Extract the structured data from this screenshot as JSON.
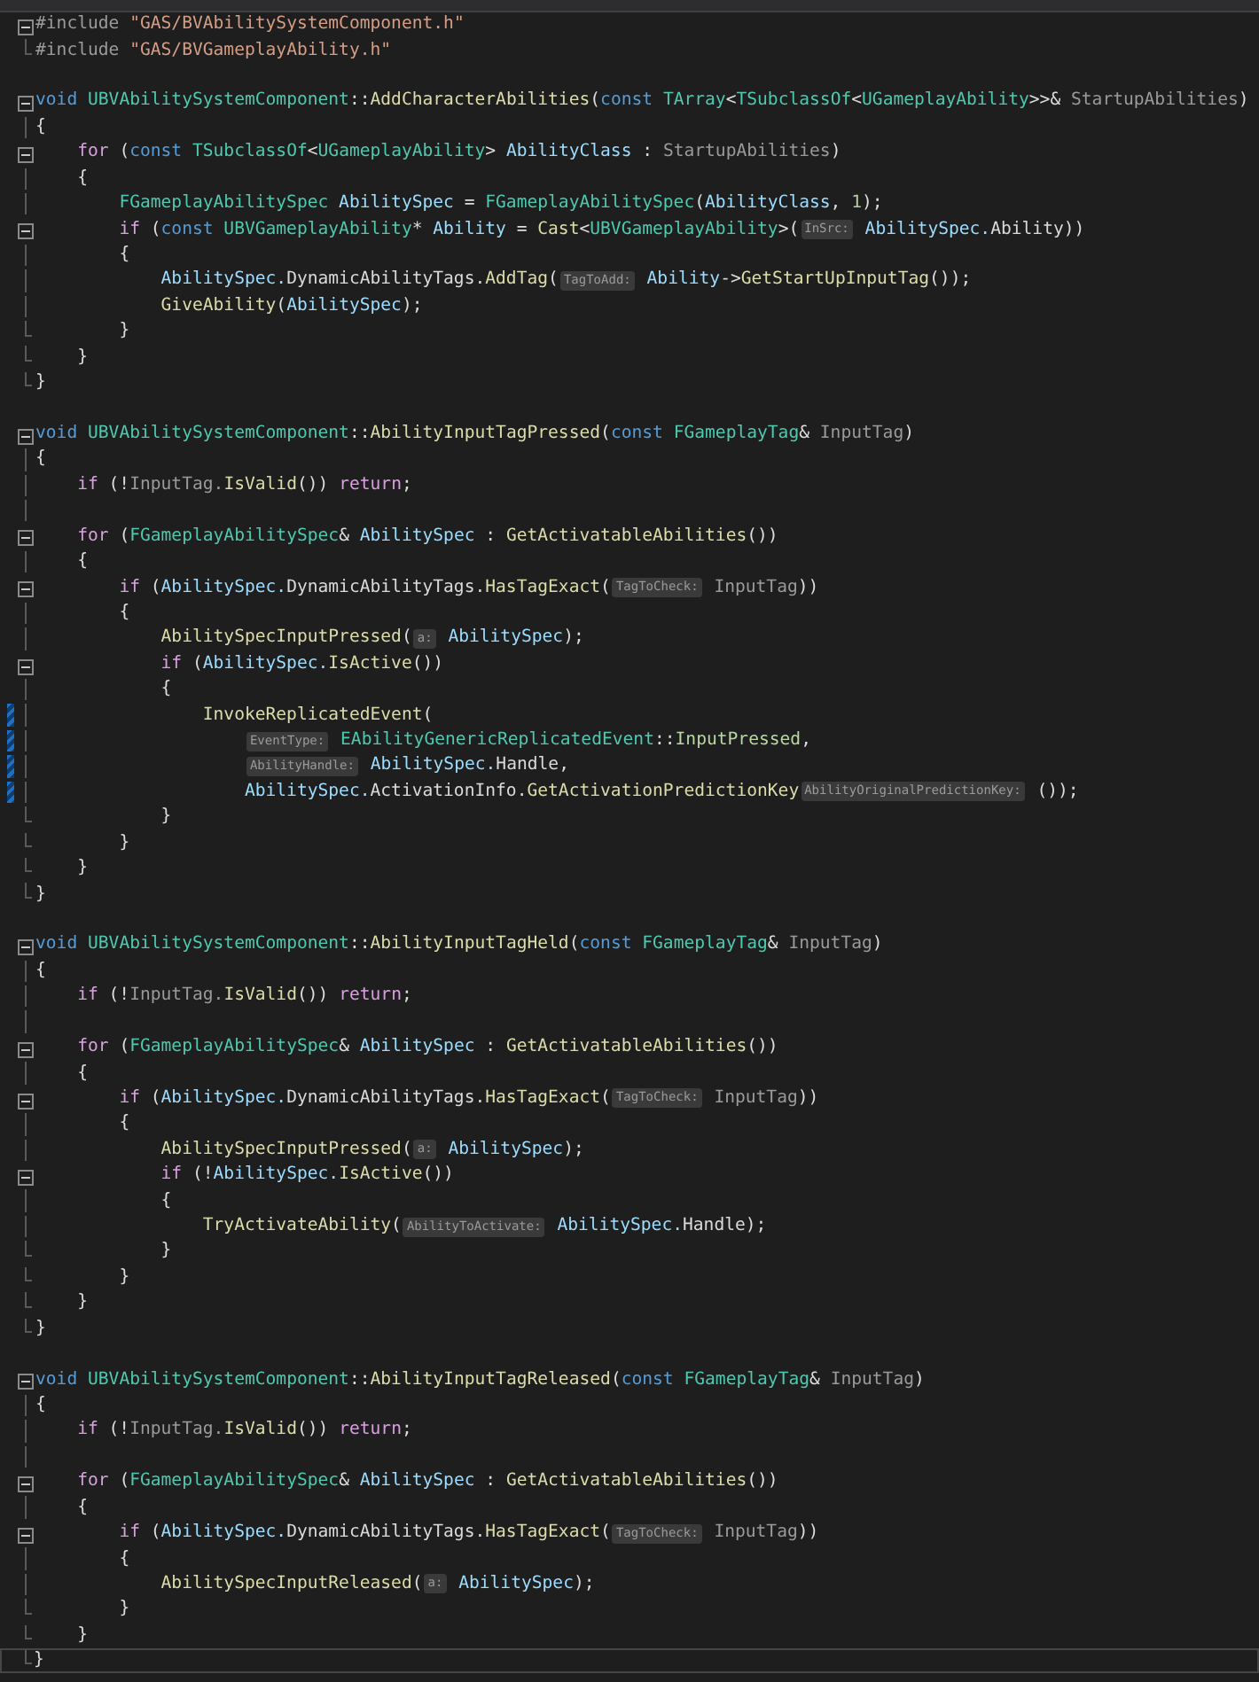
{
  "lines": [
    {
      "kind": "fold",
      "changed": false,
      "current": false,
      "tokens": [
        {
          "kind": "pre",
          "text": "#include "
        },
        {
          "kind": "str",
          "text": "\"GAS/BVAbilitySystemComponent.h\""
        }
      ]
    },
    {
      "kind": "end",
      "changed": false,
      "current": false,
      "tokens": [
        {
          "kind": "pre",
          "text": "#include "
        },
        {
          "kind": "str",
          "text": "\"GAS/BVGameplayAbility.h\""
        }
      ]
    },
    {
      "kind": "none",
      "changed": false,
      "current": false
    },
    {
      "kind": "fold",
      "changed": false,
      "current": false,
      "tokens": [
        {
          "kind": "kw",
          "text": "void "
        },
        {
          "kind": "type",
          "text": "UBVAbilitySystemComponent"
        },
        {
          "kind": "p",
          "text": "::"
        },
        {
          "kind": "fn",
          "text": "AddCharacterAbilities"
        },
        {
          "kind": "p",
          "text": "("
        },
        {
          "kind": "kw",
          "text": "const "
        },
        {
          "kind": "type",
          "text": "TArray"
        },
        {
          "kind": "p",
          "text": "<"
        },
        {
          "kind": "type",
          "text": "TSubclassOf"
        },
        {
          "kind": "p",
          "text": "<"
        },
        {
          "kind": "type",
          "text": "UGameplayAbility"
        },
        {
          "kind": "p",
          "text": ">>& "
        },
        {
          "kind": "param",
          "text": "StartupAbilities"
        },
        {
          "kind": "p",
          "text": ")"
        }
      ]
    },
    {
      "kind": "line",
      "changed": false,
      "current": false,
      "tokens": [
        {
          "kind": "p",
          "text": "{"
        }
      ]
    },
    {
      "kind": "fold",
      "changed": false,
      "current": false,
      "tokens": [
        {
          "kind": "ctl",
          "text": "    for"
        },
        {
          "kind": "p",
          "text": " ("
        },
        {
          "kind": "kw",
          "text": "const "
        },
        {
          "kind": "type",
          "text": "TSubclassOf"
        },
        {
          "kind": "p",
          "text": "<"
        },
        {
          "kind": "type",
          "text": "UGameplayAbility"
        },
        {
          "kind": "p",
          "text": "> "
        },
        {
          "kind": "var",
          "text": "AbilityClass"
        },
        {
          "kind": "p",
          "text": " : "
        },
        {
          "kind": "param",
          "text": "StartupAbilities"
        },
        {
          "kind": "p",
          "text": ")"
        }
      ]
    },
    {
      "kind": "line",
      "changed": false,
      "current": false,
      "tokens": [
        {
          "kind": "p",
          "text": "    {"
        }
      ]
    },
    {
      "kind": "line",
      "changed": false,
      "current": false,
      "tokens": [
        {
          "kind": "type",
          "text": "        FGameplayAbilitySpec"
        },
        {
          "kind": "var",
          "text": " AbilitySpec"
        },
        {
          "kind": "p",
          "text": " = "
        },
        {
          "kind": "type",
          "text": "FGameplayAbilitySpec"
        },
        {
          "kind": "p",
          "text": "("
        },
        {
          "kind": "var",
          "text": "AbilityClass"
        },
        {
          "kind": "p",
          "text": ", "
        },
        {
          "kind": "num",
          "text": "1"
        },
        {
          "kind": "p",
          "text": ");"
        }
      ]
    },
    {
      "kind": "fold",
      "changed": false,
      "current": false,
      "tokens": [
        {
          "kind": "ctl",
          "text": "        if"
        },
        {
          "kind": "p",
          "text": " ("
        },
        {
          "kind": "kw",
          "text": "const "
        },
        {
          "kind": "type",
          "text": "UBVGameplayAbility"
        },
        {
          "kind": "p",
          "text": "* "
        },
        {
          "kind": "var",
          "text": "Ability"
        },
        {
          "kind": "p",
          "text": " = "
        },
        {
          "kind": "fn",
          "text": "Cast"
        },
        {
          "kind": "p",
          "text": "<"
        },
        {
          "kind": "type",
          "text": "UBVGameplayAbility"
        },
        {
          "kind": "p",
          "text": ">("
        },
        {
          "kind": "hint",
          "text": "InSrc:"
        },
        {
          "kind": "var",
          "text": " AbilitySpec."
        },
        {
          "kind": "mem",
          "text": "Ability"
        },
        {
          "kind": "p",
          "text": "))"
        }
      ]
    },
    {
      "kind": "line",
      "changed": false,
      "current": false,
      "tokens": [
        {
          "kind": "p",
          "text": "        {"
        }
      ]
    },
    {
      "kind": "line",
      "changed": false,
      "current": false,
      "tokens": [
        {
          "kind": "var",
          "text": "            AbilitySpec."
        },
        {
          "kind": "mem",
          "text": "DynamicAbilityTags."
        },
        {
          "kind": "fn",
          "text": "AddTag"
        },
        {
          "kind": "p",
          "text": "("
        },
        {
          "kind": "hint",
          "text": "TagToAdd:"
        },
        {
          "kind": "var",
          "text": " Ability"
        },
        {
          "kind": "p",
          "text": "->"
        },
        {
          "kind": "fn",
          "text": "GetStartUpInputTag"
        },
        {
          "kind": "p",
          "text": "());"
        }
      ]
    },
    {
      "kind": "line",
      "changed": false,
      "current": false,
      "tokens": [
        {
          "kind": "fn",
          "text": "            GiveAbility"
        },
        {
          "kind": "p",
          "text": "("
        },
        {
          "kind": "var",
          "text": "AbilitySpec"
        },
        {
          "kind": "p",
          "text": ");"
        }
      ]
    },
    {
      "kind": "end",
      "changed": false,
      "current": false,
      "tokens": [
        {
          "kind": "p",
          "text": "        }"
        }
      ]
    },
    {
      "kind": "end",
      "changed": false,
      "current": false,
      "tokens": [
        {
          "kind": "p",
          "text": "    }"
        }
      ]
    },
    {
      "kind": "end",
      "changed": false,
      "current": false,
      "tokens": [
        {
          "kind": "p",
          "text": "}"
        }
      ]
    },
    {
      "kind": "none",
      "changed": false,
      "current": false
    },
    {
      "kind": "fold",
      "changed": false,
      "current": false,
      "tokens": [
        {
          "kind": "kw",
          "text": "void "
        },
        {
          "kind": "type",
          "text": "UBVAbilitySystemComponent"
        },
        {
          "kind": "p",
          "text": "::"
        },
        {
          "kind": "fn",
          "text": "AbilityInputTagPressed"
        },
        {
          "kind": "p",
          "text": "("
        },
        {
          "kind": "kw",
          "text": "const "
        },
        {
          "kind": "type",
          "text": "FGameplayTag"
        },
        {
          "kind": "p",
          "text": "& "
        },
        {
          "kind": "param",
          "text": "InputTag"
        },
        {
          "kind": "p",
          "text": ")"
        }
      ]
    },
    {
      "kind": "line",
      "changed": false,
      "current": false,
      "tokens": [
        {
          "kind": "p",
          "text": "{"
        }
      ]
    },
    {
      "kind": "line",
      "changed": false,
      "current": false,
      "tokens": [
        {
          "kind": "ctl",
          "text": "    if"
        },
        {
          "kind": "p",
          "text": " (!"
        },
        {
          "kind": "param",
          "text": "InputTag."
        },
        {
          "kind": "fn",
          "text": "IsValid"
        },
        {
          "kind": "p",
          "text": "()) "
        },
        {
          "kind": "ctl",
          "text": "return"
        },
        {
          "kind": "p",
          "text": ";"
        }
      ]
    },
    {
      "kind": "line",
      "changed": false,
      "current": false
    },
    {
      "kind": "fold",
      "changed": false,
      "current": false,
      "tokens": [
        {
          "kind": "ctl",
          "text": "    for"
        },
        {
          "kind": "p",
          "text": " ("
        },
        {
          "kind": "type",
          "text": "FGameplayAbilitySpec"
        },
        {
          "kind": "p",
          "text": "& "
        },
        {
          "kind": "var",
          "text": "AbilitySpec"
        },
        {
          "kind": "p",
          "text": " : "
        },
        {
          "kind": "fn",
          "text": "GetActivatableAbilities"
        },
        {
          "kind": "p",
          "text": "())"
        }
      ]
    },
    {
      "kind": "line",
      "changed": false,
      "current": false,
      "tokens": [
        {
          "kind": "p",
          "text": "    {"
        }
      ]
    },
    {
      "kind": "fold",
      "changed": false,
      "current": false,
      "tokens": [
        {
          "kind": "ctl",
          "text": "        if"
        },
        {
          "kind": "p",
          "text": " ("
        },
        {
          "kind": "var",
          "text": "AbilitySpec."
        },
        {
          "kind": "mem",
          "text": "DynamicAbilityTags."
        },
        {
          "kind": "fn",
          "text": "HasTagExact"
        },
        {
          "kind": "p",
          "text": "("
        },
        {
          "kind": "hint",
          "text": "TagToCheck:"
        },
        {
          "kind": "param",
          "text": " InputTag"
        },
        {
          "kind": "p",
          "text": "))"
        }
      ]
    },
    {
      "kind": "line",
      "changed": false,
      "current": false,
      "tokens": [
        {
          "kind": "p",
          "text": "        {"
        }
      ]
    },
    {
      "kind": "line",
      "changed": false,
      "current": false,
      "tokens": [
        {
          "kind": "fn",
          "text": "            AbilitySpecInputPressed"
        },
        {
          "kind": "p",
          "text": "("
        },
        {
          "kind": "hint",
          "text": "a:"
        },
        {
          "kind": "var",
          "text": " AbilitySpec"
        },
        {
          "kind": "p",
          "text": ");"
        }
      ]
    },
    {
      "kind": "fold",
      "changed": false,
      "current": false,
      "tokens": [
        {
          "kind": "ctl",
          "text": "            if"
        },
        {
          "kind": "p",
          "text": " ("
        },
        {
          "kind": "var",
          "text": "AbilitySpec."
        },
        {
          "kind": "fn",
          "text": "IsActive"
        },
        {
          "kind": "p",
          "text": "())"
        }
      ]
    },
    {
      "kind": "line",
      "changed": false,
      "current": false,
      "tokens": [
        {
          "kind": "p",
          "text": "            {"
        }
      ]
    },
    {
      "kind": "line",
      "changed": true,
      "current": false,
      "tokens": [
        {
          "kind": "fn",
          "text": "                InvokeReplicatedEvent"
        },
        {
          "kind": "p",
          "text": "("
        }
      ]
    },
    {
      "kind": "line",
      "changed": true,
      "current": false,
      "tokens": [
        {
          "kind": "hint",
          "text": "                    EventType:"
        },
        {
          "kind": "type",
          "text": " EAbilityGenericReplicatedEvent"
        },
        {
          "kind": "p",
          "text": "::"
        },
        {
          "kind": "enum",
          "text": "InputPressed"
        },
        {
          "kind": "p",
          "text": ","
        }
      ]
    },
    {
      "kind": "line",
      "changed": true,
      "current": false,
      "tokens": [
        {
          "kind": "hint",
          "text": "                    AbilityHandle:"
        },
        {
          "kind": "var",
          "text": " AbilitySpec."
        },
        {
          "kind": "mem",
          "text": "Handle"
        },
        {
          "kind": "p",
          "text": ","
        }
      ]
    },
    {
      "kind": "line",
      "changed": true,
      "current": false,
      "tokens": [
        {
          "kind": "var",
          "text": "                    AbilitySpec."
        },
        {
          "kind": "mem",
          "text": "ActivationInfo."
        },
        {
          "kind": "fn",
          "text": "GetActivationPredictionKey"
        },
        {
          "kind": "hint",
          "text": "AbilityOriginalPredictionKey:"
        },
        {
          "kind": "p",
          "text": " ());"
        }
      ]
    },
    {
      "kind": "end",
      "changed": false,
      "current": false,
      "tokens": [
        {
          "kind": "p",
          "text": "            }"
        }
      ]
    },
    {
      "kind": "end",
      "changed": false,
      "current": false,
      "tokens": [
        {
          "kind": "p",
          "text": "        }"
        }
      ]
    },
    {
      "kind": "end",
      "changed": false,
      "current": false,
      "tokens": [
        {
          "kind": "p",
          "text": "    }"
        }
      ]
    },
    {
      "kind": "end",
      "changed": false,
      "current": false,
      "tokens": [
        {
          "kind": "p",
          "text": "}"
        }
      ]
    },
    {
      "kind": "none",
      "changed": false,
      "current": false
    },
    {
      "kind": "fold",
      "changed": false,
      "current": false,
      "tokens": [
        {
          "kind": "kw",
          "text": "void "
        },
        {
          "kind": "type",
          "text": "UBVAbilitySystemComponent"
        },
        {
          "kind": "p",
          "text": "::"
        },
        {
          "kind": "fn",
          "text": "AbilityInputTagHeld"
        },
        {
          "kind": "p",
          "text": "("
        },
        {
          "kind": "kw",
          "text": "const "
        },
        {
          "kind": "type",
          "text": "FGameplayTag"
        },
        {
          "kind": "p",
          "text": "& "
        },
        {
          "kind": "param",
          "text": "InputTag"
        },
        {
          "kind": "p",
          "text": ")"
        }
      ]
    },
    {
      "kind": "line",
      "changed": false,
      "current": false,
      "tokens": [
        {
          "kind": "p",
          "text": "{"
        }
      ]
    },
    {
      "kind": "line",
      "changed": false,
      "current": false,
      "tokens": [
        {
          "kind": "ctl",
          "text": "    if"
        },
        {
          "kind": "p",
          "text": " (!"
        },
        {
          "kind": "param",
          "text": "InputTag."
        },
        {
          "kind": "fn",
          "text": "IsValid"
        },
        {
          "kind": "p",
          "text": "()) "
        },
        {
          "kind": "ctl",
          "text": "return"
        },
        {
          "kind": "p",
          "text": ";"
        }
      ]
    },
    {
      "kind": "line",
      "changed": false,
      "current": false
    },
    {
      "kind": "fold",
      "changed": false,
      "current": false,
      "tokens": [
        {
          "kind": "ctl",
          "text": "    for"
        },
        {
          "kind": "p",
          "text": " ("
        },
        {
          "kind": "type",
          "text": "FGameplayAbilitySpec"
        },
        {
          "kind": "p",
          "text": "& "
        },
        {
          "kind": "var",
          "text": "AbilitySpec"
        },
        {
          "kind": "p",
          "text": " : "
        },
        {
          "kind": "fn",
          "text": "GetActivatableAbilities"
        },
        {
          "kind": "p",
          "text": "())"
        }
      ]
    },
    {
      "kind": "line",
      "changed": false,
      "current": false,
      "tokens": [
        {
          "kind": "p",
          "text": "    {"
        }
      ]
    },
    {
      "kind": "fold",
      "changed": false,
      "current": false,
      "tokens": [
        {
          "kind": "ctl",
          "text": "        if"
        },
        {
          "kind": "p",
          "text": " ("
        },
        {
          "kind": "var",
          "text": "AbilitySpec."
        },
        {
          "kind": "mem",
          "text": "DynamicAbilityTags."
        },
        {
          "kind": "fn",
          "text": "HasTagExact"
        },
        {
          "kind": "p",
          "text": "("
        },
        {
          "kind": "hint",
          "text": "TagToCheck:"
        },
        {
          "kind": "param",
          "text": " InputTag"
        },
        {
          "kind": "p",
          "text": "))"
        }
      ]
    },
    {
      "kind": "line",
      "changed": false,
      "current": false,
      "tokens": [
        {
          "kind": "p",
          "text": "        {"
        }
      ]
    },
    {
      "kind": "line",
      "changed": false,
      "current": false,
      "tokens": [
        {
          "kind": "fn",
          "text": "            AbilitySpecInputPressed"
        },
        {
          "kind": "p",
          "text": "("
        },
        {
          "kind": "hint",
          "text": "a:"
        },
        {
          "kind": "var",
          "text": " AbilitySpec"
        },
        {
          "kind": "p",
          "text": ");"
        }
      ]
    },
    {
      "kind": "fold",
      "changed": false,
      "current": false,
      "tokens": [
        {
          "kind": "ctl",
          "text": "            if"
        },
        {
          "kind": "p",
          "text": " (!"
        },
        {
          "kind": "var",
          "text": "AbilitySpec."
        },
        {
          "kind": "fn",
          "text": "IsActive"
        },
        {
          "kind": "p",
          "text": "())"
        }
      ]
    },
    {
      "kind": "line",
      "changed": false,
      "current": false,
      "tokens": [
        {
          "kind": "p",
          "text": "            {"
        }
      ]
    },
    {
      "kind": "line",
      "changed": false,
      "current": false,
      "tokens": [
        {
          "kind": "fn",
          "text": "                TryActivateAbility"
        },
        {
          "kind": "p",
          "text": "("
        },
        {
          "kind": "hint",
          "text": "AbilityToActivate:"
        },
        {
          "kind": "var",
          "text": " AbilitySpec."
        },
        {
          "kind": "mem",
          "text": "Handle"
        },
        {
          "kind": "p",
          "text": ");"
        }
      ]
    },
    {
      "kind": "end",
      "changed": false,
      "current": false,
      "tokens": [
        {
          "kind": "p",
          "text": "            }"
        }
      ]
    },
    {
      "kind": "end",
      "changed": false,
      "current": false,
      "tokens": [
        {
          "kind": "p",
          "text": "        }"
        }
      ]
    },
    {
      "kind": "end",
      "changed": false,
      "current": false,
      "tokens": [
        {
          "kind": "p",
          "text": "    }"
        }
      ]
    },
    {
      "kind": "end",
      "changed": false,
      "current": false,
      "tokens": [
        {
          "kind": "p",
          "text": "}"
        }
      ]
    },
    {
      "kind": "none",
      "changed": false,
      "current": false
    },
    {
      "kind": "fold",
      "changed": false,
      "current": false,
      "tokens": [
        {
          "kind": "kw",
          "text": "void "
        },
        {
          "kind": "type",
          "text": "UBVAbilitySystemComponent"
        },
        {
          "kind": "p",
          "text": "::"
        },
        {
          "kind": "fn",
          "text": "AbilityInputTagReleased"
        },
        {
          "kind": "p",
          "text": "("
        },
        {
          "kind": "kw",
          "text": "const "
        },
        {
          "kind": "type",
          "text": "FGameplayTag"
        },
        {
          "kind": "p",
          "text": "& "
        },
        {
          "kind": "param",
          "text": "InputTag"
        },
        {
          "kind": "p",
          "text": ")"
        }
      ]
    },
    {
      "kind": "line",
      "changed": false,
      "current": false,
      "tokens": [
        {
          "kind": "p",
          "text": "{"
        }
      ]
    },
    {
      "kind": "line",
      "changed": false,
      "current": false,
      "tokens": [
        {
          "kind": "ctl",
          "text": "    if"
        },
        {
          "kind": "p",
          "text": " (!"
        },
        {
          "kind": "param",
          "text": "InputTag."
        },
        {
          "kind": "fn",
          "text": "IsValid"
        },
        {
          "kind": "p",
          "text": "()) "
        },
        {
          "kind": "ctl",
          "text": "return"
        },
        {
          "kind": "p",
          "text": ";"
        }
      ]
    },
    {
      "kind": "line",
      "changed": false,
      "current": false
    },
    {
      "kind": "fold",
      "changed": false,
      "current": false,
      "tokens": [
        {
          "kind": "ctl",
          "text": "    for"
        },
        {
          "kind": "p",
          "text": " ("
        },
        {
          "kind": "type",
          "text": "FGameplayAbilitySpec"
        },
        {
          "kind": "p",
          "text": "& "
        },
        {
          "kind": "var",
          "text": "AbilitySpec"
        },
        {
          "kind": "p",
          "text": " : "
        },
        {
          "kind": "fn",
          "text": "GetActivatableAbilities"
        },
        {
          "kind": "p",
          "text": "())"
        }
      ]
    },
    {
      "kind": "line",
      "changed": false,
      "current": false,
      "tokens": [
        {
          "kind": "p",
          "text": "    {"
        }
      ]
    },
    {
      "kind": "fold",
      "changed": false,
      "current": false,
      "tokens": [
        {
          "kind": "ctl",
          "text": "        if"
        },
        {
          "kind": "p",
          "text": " ("
        },
        {
          "kind": "var",
          "text": "AbilitySpec."
        },
        {
          "kind": "mem",
          "text": "DynamicAbilityTags."
        },
        {
          "kind": "fn",
          "text": "HasTagExact"
        },
        {
          "kind": "p",
          "text": "("
        },
        {
          "kind": "hint",
          "text": "TagToCheck:"
        },
        {
          "kind": "param",
          "text": " InputTag"
        },
        {
          "kind": "p",
          "text": "))"
        }
      ]
    },
    {
      "kind": "line",
      "changed": false,
      "current": false,
      "tokens": [
        {
          "kind": "p",
          "text": "        {"
        }
      ]
    },
    {
      "kind": "line",
      "changed": false,
      "current": false,
      "tokens": [
        {
          "kind": "fn",
          "text": "            AbilitySpecInputReleased"
        },
        {
          "kind": "p",
          "text": "("
        },
        {
          "kind": "hint",
          "text": "a:"
        },
        {
          "kind": "var",
          "text": " AbilitySpec"
        },
        {
          "kind": "p",
          "text": ");"
        }
      ]
    },
    {
      "kind": "end",
      "changed": false,
      "current": false,
      "tokens": [
        {
          "kind": "p",
          "text": "        }"
        }
      ]
    },
    {
      "kind": "end",
      "changed": false,
      "current": false,
      "tokens": [
        {
          "kind": "p",
          "text": "    }"
        }
      ]
    },
    {
      "kind": "end",
      "changed": false,
      "current": true,
      "tokens": [
        {
          "kind": "p",
          "text": "}"
        }
      ]
    }
  ]
}
